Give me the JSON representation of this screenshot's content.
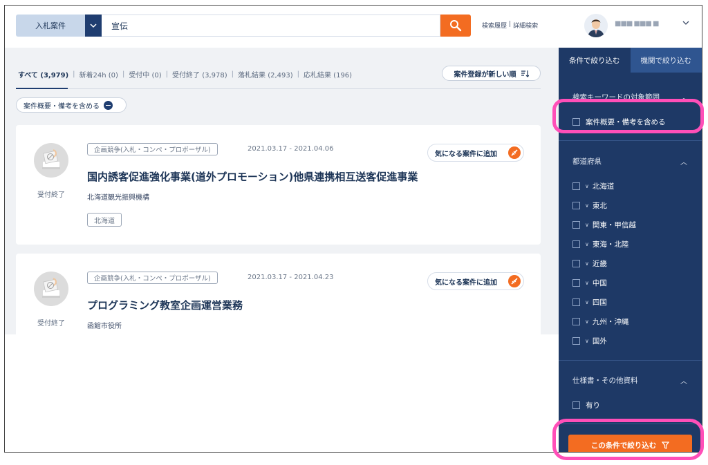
{
  "header": {
    "category_label": "入札案件",
    "search_value": "宣伝",
    "links": [
      "検索履歴",
      "|",
      "詳細検索"
    ],
    "username": "■■■ ■■■ ■",
    "colors": {
      "accent": "#f36c21",
      "navy": "#1e3966",
      "category_bg": "#c8d7ea"
    }
  },
  "main": {
    "tabs": [
      {
        "label": "すべて (3,979)"
      },
      {
        "label": "新着24h (0)"
      },
      {
        "label": "受付中 (0)"
      },
      {
        "label": "受付終了 (3,978)"
      },
      {
        "label": "落札結果 (2,493)"
      },
      {
        "label": "応札結果 (196)"
      }
    ],
    "sort_label": "案件登録が新しい順",
    "include_chip": "案件概要・備考を含める",
    "cards": [
      {
        "status": "受付終了",
        "type": "企画競争(入札・コンペ・プロポーザル)",
        "period": "2021.03.17 - 2021.04.06",
        "fav_label": "気になる案件に追加",
        "title": "国内誘客促進強化事業(道外プロモーション)他県連携相互送客促進事業",
        "org": "北海道観光振興機構",
        "region": "北海道"
      },
      {
        "status": "受付終了",
        "type": "企画競争(入札・コンペ・プロポーザル)",
        "period": "2021.03.17 - 2021.04.23",
        "fav_label": "気になる案件に追加",
        "title": "プログラミング教室企画運営業務",
        "org": "函館市役所"
      }
    ]
  },
  "side": {
    "tabs": [
      "条件で絞り込む",
      "機関で絞り込む"
    ],
    "keyword_section": {
      "title": "検索キーワードの対象範囲",
      "option": "案件概要・備考を含める"
    },
    "prefecture_section": {
      "title": "都道府県",
      "regions": [
        "北海道",
        "東北",
        "関東・甲信越",
        "東海・北陸",
        "近畿",
        "中国",
        "四国",
        "九州・沖縄",
        "国外"
      ]
    },
    "spec_section": {
      "title": "仕様書・その他資料",
      "option": "有り"
    },
    "apply_label": "この条件で絞り込む"
  }
}
